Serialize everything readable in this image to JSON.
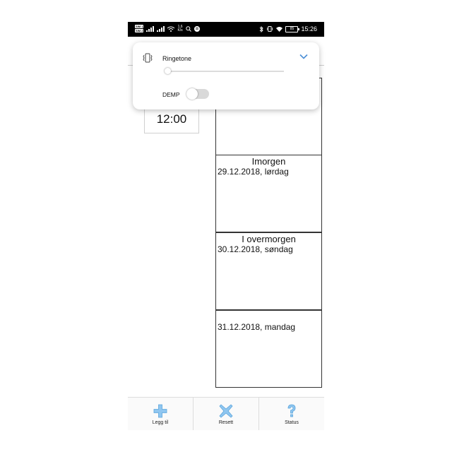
{
  "status_bar": {
    "sim1": "SIM 1",
    "sim2": "SIM 2",
    "speed_value": "1,6",
    "speed_unit": "K/s",
    "battery": "85",
    "time": "15:26"
  },
  "clock": {
    "value": "12:00"
  },
  "days": [
    {
      "title": "",
      "date": ""
    },
    {
      "title": "Imorgen",
      "date": "29.12.2018, lørdag"
    },
    {
      "title": "I overmorgen",
      "date": "30.12.2018, søndag"
    },
    {
      "title": "",
      "date": "31.12.2018, mandag"
    }
  ],
  "volume_panel": {
    "stream_label": "Ringetone",
    "level_fraction": 0.0,
    "mute_label": "DEMP",
    "mute_on": false
  },
  "bottom_bar": {
    "add_label": "Legg til",
    "reset_label": "Resett",
    "status_label": "Status"
  },
  "colors": {
    "accent_blue": "#4d8fd6",
    "icon_blue": "#8fc6f0"
  },
  "icons": {
    "vibrate": "vibrate-icon",
    "expand": "chevron-down-icon",
    "add": "plus-icon",
    "reset": "x-icon",
    "status": "question-icon"
  }
}
